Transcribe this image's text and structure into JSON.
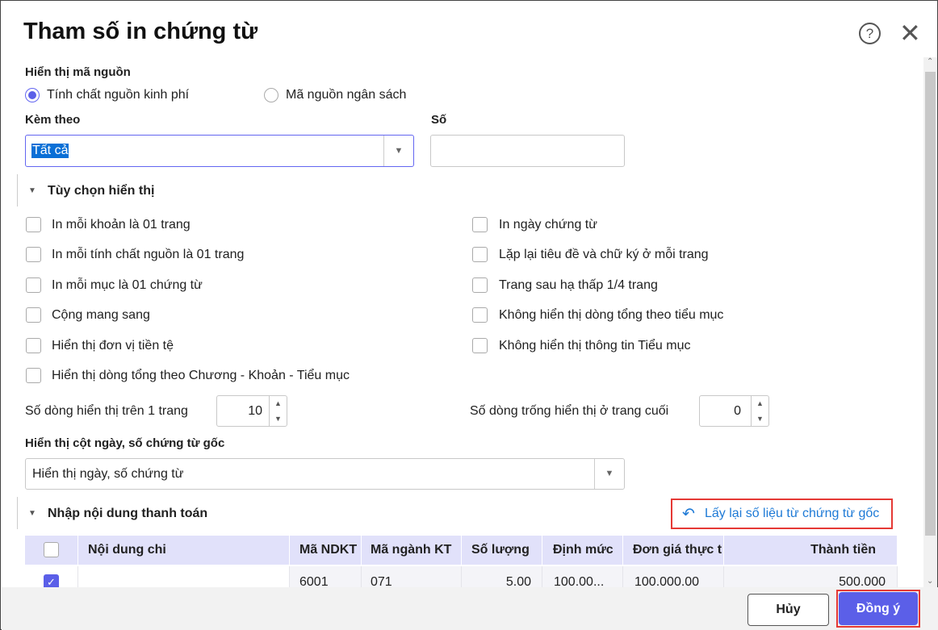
{
  "title": "Tham số in chứng từ",
  "source_display": {
    "label": "Hiển thị mã nguồn",
    "options": [
      "Tính chất nguồn kinh phí",
      "Mã nguồn ngân sách"
    ],
    "selected": 0
  },
  "attach": {
    "label": "Kèm theo",
    "value": "Tất cả"
  },
  "number": {
    "label": "Số",
    "value": ""
  },
  "display_options": {
    "title": "Tùy chọn hiển thị",
    "left": [
      "In mỗi khoản là 01 trang",
      "In mỗi tính chất nguồn là 01 trang",
      "In mỗi mục là 01 chứng từ",
      "Cộng mang sang",
      "Hiển thị đơn vị tiền tệ",
      "Hiển thị dòng tổng theo Chương - Khoản - Tiểu mục"
    ],
    "right": [
      "In ngày chứng từ",
      "Lặp lại tiêu đề và chữ ký ở mỗi trang",
      "Trang sau hạ thấp 1/4 trang",
      "Không hiển thị dòng tổng theo tiểu mục",
      "Không hiển thị thông tin Tiểu mục"
    ]
  },
  "rows_per_page": {
    "label": "Số dòng hiển thị trên 1 trang",
    "value": "10"
  },
  "blank_rows": {
    "label": "Số dòng trống hiển thị ở trang cuối",
    "value": "0"
  },
  "date_col": {
    "label": "Hiển thị cột ngày, số chứng từ gốc",
    "value": "Hiển thị ngày, số chứng từ"
  },
  "payment": {
    "title": "Nhập nội dung thanh toán",
    "reload_link": "Lấy lại số liệu từ chứng từ gốc",
    "columns": [
      "Nội dung chi",
      "Mã NDKT",
      "Mã ngành KT",
      "Số lượng",
      "Định mức",
      "Đơn giá thực t",
      "Thành tiền"
    ],
    "rows": [
      {
        "checked": true,
        "cells": [
          "",
          "6001",
          "071",
          "5.00",
          "100.00...",
          "100.000.00",
          "500.000"
        ]
      }
    ]
  },
  "footer": {
    "cancel": "Hủy",
    "ok": "Đồng ý"
  },
  "colors": {
    "accent": "#5b5fe8",
    "highlight": "#e53935",
    "link": "#1e7ad6"
  }
}
